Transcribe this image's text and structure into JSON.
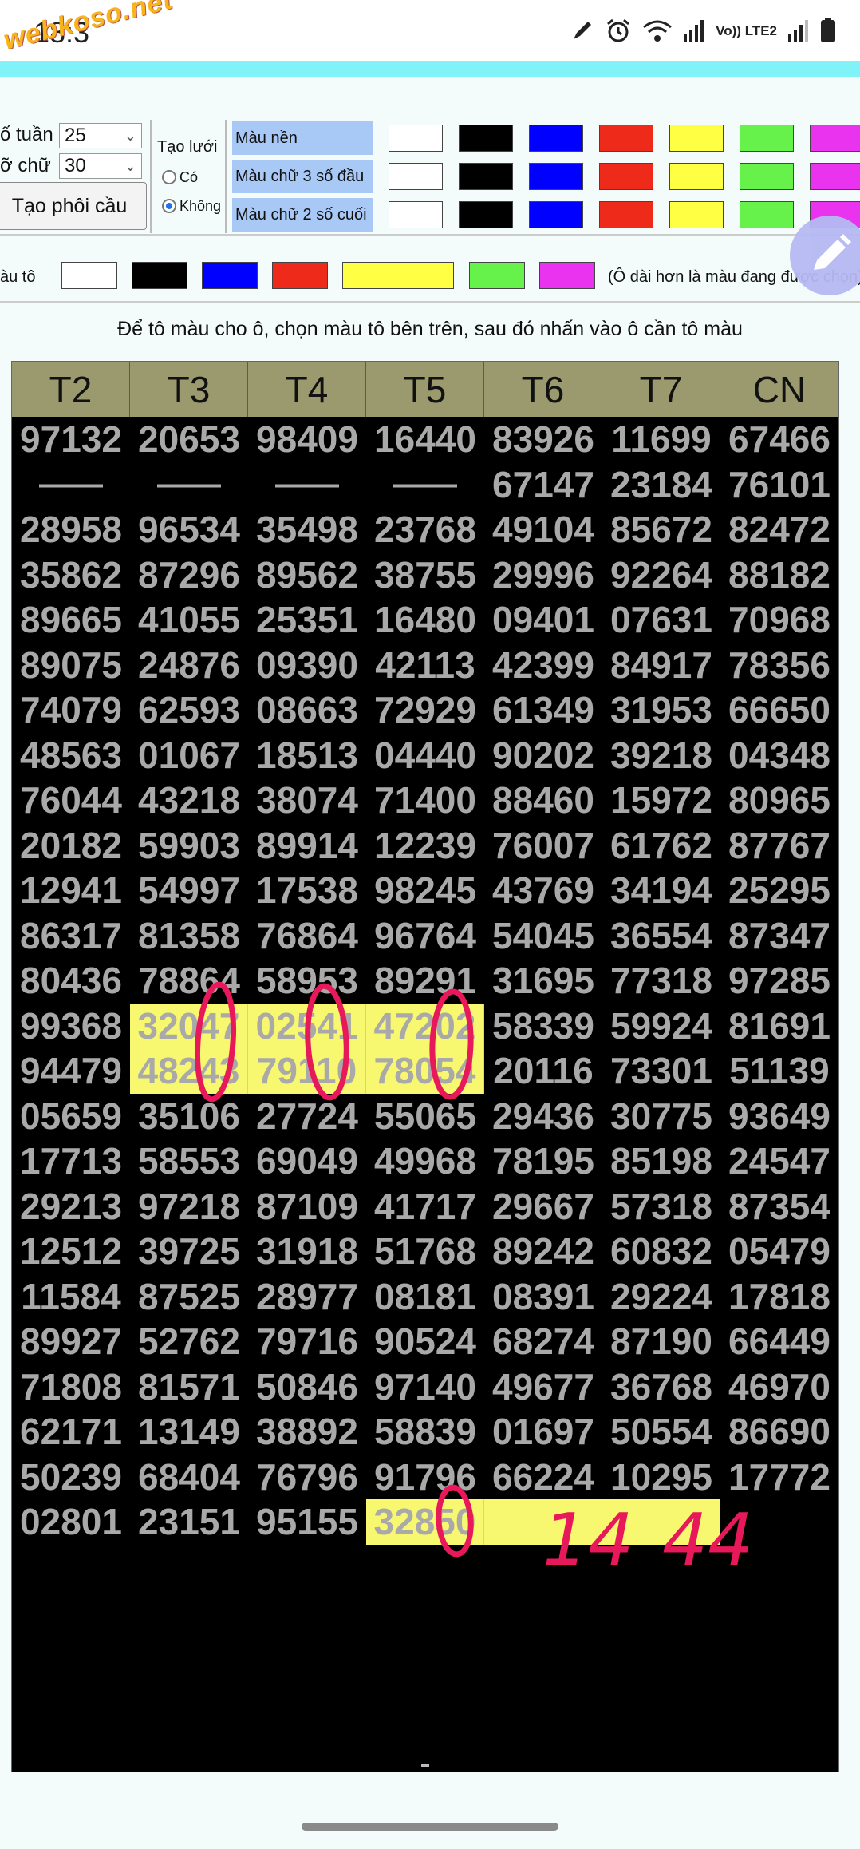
{
  "status_bar": {
    "time": "18:3",
    "watermark": "webkoso.net",
    "network_label": "Vo)) LTE2"
  },
  "controls": {
    "so_tuan_label": "ố tuần",
    "so_tuan_value": "25",
    "co_chu_label": "ỡ chữ",
    "co_chu_value": "30",
    "generate_button": "Tạo phôi cầu",
    "grid_label": "Tạo lưới",
    "grid_option_yes": "Có",
    "grid_option_no": "Không",
    "grid_selected": "Không",
    "color_rows": [
      "Màu nền",
      "Màu chữ 3 số đầu",
      "Màu chữ 2 số cuối"
    ],
    "paint_label": "àu tô",
    "paint_note": "(Ô dài hơn là màu đang được chọn)",
    "instruction": "Để tô màu cho ô, chọn màu tô bên trên, sau đó nhấn vào ô cần tô màu"
  },
  "palette": [
    "#ffffff",
    "#000000",
    "#0000ff",
    "#ee2a1a",
    "#ffff44",
    "#66f24a",
    "#ea33ee"
  ],
  "table": {
    "headers": [
      "T2",
      "T3",
      "T4",
      "T5",
      "T6",
      "T7",
      "CN"
    ],
    "rows": [
      [
        "97132",
        "20653",
        "98409",
        "16440",
        "83926",
        "11699",
        "67466"
      ],
      [
        "——",
        "——",
        "——",
        "——",
        "67147",
        "23184",
        "76101"
      ],
      [
        "28958",
        "96534",
        "35498",
        "23768",
        "49104",
        "85672",
        "82472"
      ],
      [
        "35862",
        "87296",
        "89562",
        "38755",
        "29996",
        "92264",
        "88182"
      ],
      [
        "89665",
        "41055",
        "25351",
        "16480",
        "09401",
        "07631",
        "70968"
      ],
      [
        "89075",
        "24876",
        "09390",
        "42113",
        "42399",
        "84917",
        "78356"
      ],
      [
        "74079",
        "62593",
        "08663",
        "72929",
        "61349",
        "31953",
        "66650"
      ],
      [
        "48563",
        "01067",
        "18513",
        "04440",
        "90202",
        "39218",
        "04348"
      ],
      [
        "76044",
        "43218",
        "38074",
        "71400",
        "88460",
        "15972",
        "80965"
      ],
      [
        "20182",
        "59903",
        "89914",
        "12239",
        "76007",
        "61762",
        "87767"
      ],
      [
        "12941",
        "54997",
        "17538",
        "98245",
        "43769",
        "34194",
        "25295"
      ],
      [
        "86317",
        "81358",
        "76864",
        "96764",
        "54045",
        "36554",
        "87347"
      ],
      [
        "80436",
        "78864",
        "58953",
        "89291",
        "31695",
        "77318",
        "97285"
      ],
      [
        "99368",
        "32047",
        "02541",
        "47202",
        "58339",
        "59924",
        "81691"
      ],
      [
        "94479",
        "48243",
        "79110",
        "78054",
        "20116",
        "73301",
        "51139"
      ],
      [
        "05659",
        "35106",
        "27724",
        "55065",
        "29436",
        "30775",
        "93649"
      ],
      [
        "17713",
        "58553",
        "69049",
        "49968",
        "78195",
        "85198",
        "24547"
      ],
      [
        "29213",
        "97218",
        "87109",
        "41717",
        "29667",
        "57318",
        "87354"
      ],
      [
        "12512",
        "39725",
        "31918",
        "51768",
        "89242",
        "60832",
        "05479"
      ],
      [
        "11584",
        "87525",
        "28977",
        "08181",
        "08391",
        "29224",
        "17818"
      ],
      [
        "89927",
        "52762",
        "79716",
        "90524",
        "68274",
        "87190",
        "66449"
      ],
      [
        "71808",
        "81571",
        "50846",
        "97140",
        "49677",
        "36768",
        "46970"
      ],
      [
        "62171",
        "13149",
        "38892",
        "58839",
        "01697",
        "50554",
        "86690"
      ],
      [
        "50239",
        "68404",
        "76796",
        "91796",
        "66224",
        "10295",
        "17772"
      ],
      [
        "02801",
        "23151",
        "95155",
        "32850",
        "",
        "",
        ""
      ]
    ],
    "highlighted_cells": [
      [
        13,
        1
      ],
      [
        13,
        2
      ],
      [
        13,
        3
      ],
      [
        14,
        1
      ],
      [
        14,
        2
      ],
      [
        14,
        3
      ],
      [
        24,
        3
      ],
      [
        24,
        4
      ],
      [
        24,
        5
      ]
    ],
    "highlight_color": "#f8f870",
    "footer_mark": "-"
  },
  "annotations": {
    "handwritten_1": "14",
    "handwritten_2": "44",
    "ink_color": "#e8195a"
  }
}
